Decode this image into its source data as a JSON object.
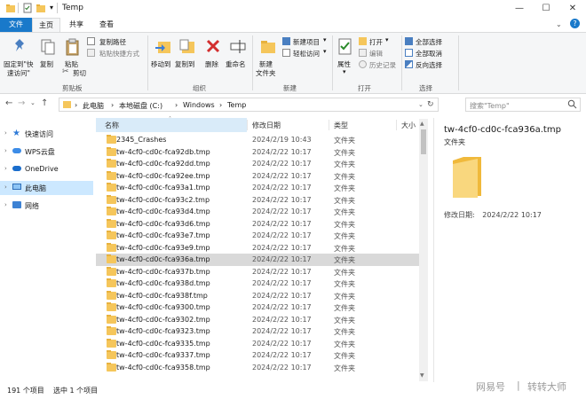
{
  "window": {
    "title": "Temp",
    "controls": {
      "minimize": "—",
      "maximize": "☐",
      "close": "✕"
    }
  },
  "tabs": {
    "file": "文件",
    "home": "主页",
    "share": "共享",
    "view": "查看"
  },
  "ribbon": {
    "clipboard": {
      "group": "剪贴板",
      "pin_line1": "固定到\"快",
      "pin_line2": "速访问\"",
      "copy": "复制",
      "paste": "粘贴",
      "copy_path": "复制路径",
      "paste_shortcut": "粘贴快捷方式",
      "cut": "剪切"
    },
    "organize": {
      "group": "组织",
      "move_to": "移动到",
      "copy_to": "复制到",
      "delete": "删除",
      "rename": "重命名"
    },
    "new": {
      "group": "新建",
      "new_folder_line1": "新建",
      "new_folder_line2": "文件夹",
      "new_item": "新建项目",
      "easy_access": "轻松访问"
    },
    "open": {
      "group": "打开",
      "properties": "属性",
      "open": "打开",
      "edit": "编辑",
      "history": "历史记录"
    },
    "select": {
      "group": "选择",
      "select_all": "全部选择",
      "select_none": "全部取消",
      "invert": "反向选择"
    }
  },
  "address": {
    "crumbs": [
      "此电脑",
      "本地磁盘 (C:)",
      "Windows",
      "Temp"
    ],
    "search_placeholder": "搜索\"Temp\""
  },
  "nav": {
    "items": [
      "快速访问",
      "WPS云盘",
      "OneDrive",
      "此电脑",
      "网络"
    ]
  },
  "columns": {
    "name": "名称",
    "date": "修改日期",
    "type": "类型",
    "size": "大小"
  },
  "files": [
    {
      "name": "2345_Crashes",
      "date": "2024/2/19 10:43",
      "type": "文件夹"
    },
    {
      "name": "tw-4cf0-cd0c-fca92db.tmp",
      "date": "2024/2/22 10:17",
      "type": "文件夹"
    },
    {
      "name": "tw-4cf0-cd0c-fca92dd.tmp",
      "date": "2024/2/22 10:17",
      "type": "文件夹"
    },
    {
      "name": "tw-4cf0-cd0c-fca92ee.tmp",
      "date": "2024/2/22 10:17",
      "type": "文件夹"
    },
    {
      "name": "tw-4cf0-cd0c-fca93a1.tmp",
      "date": "2024/2/22 10:17",
      "type": "文件夹"
    },
    {
      "name": "tw-4cf0-cd0c-fca93c2.tmp",
      "date": "2024/2/22 10:17",
      "type": "文件夹"
    },
    {
      "name": "tw-4cf0-cd0c-fca93d4.tmp",
      "date": "2024/2/22 10:17",
      "type": "文件夹"
    },
    {
      "name": "tw-4cf0-cd0c-fca93d6.tmp",
      "date": "2024/2/22 10:17",
      "type": "文件夹"
    },
    {
      "name": "tw-4cf0-cd0c-fca93e7.tmp",
      "date": "2024/2/22 10:17",
      "type": "文件夹"
    },
    {
      "name": "tw-4cf0-cd0c-fca93e9.tmp",
      "date": "2024/2/22 10:17",
      "type": "文件夹"
    },
    {
      "name": "tw-4cf0-cd0c-fca936a.tmp",
      "date": "2024/2/22 10:17",
      "type": "文件夹"
    },
    {
      "name": "tw-4cf0-cd0c-fca937b.tmp",
      "date": "2024/2/22 10:17",
      "type": "文件夹"
    },
    {
      "name": "tw-4cf0-cd0c-fca938d.tmp",
      "date": "2024/2/22 10:17",
      "type": "文件夹"
    },
    {
      "name": "tw-4cf0-cd0c-fca938f.tmp",
      "date": "2024/2/22 10:17",
      "type": "文件夹"
    },
    {
      "name": "tw-4cf0-cd0c-fca9300.tmp",
      "date": "2024/2/22 10:17",
      "type": "文件夹"
    },
    {
      "name": "tw-4cf0-cd0c-fca9302.tmp",
      "date": "2024/2/22 10:17",
      "type": "文件夹"
    },
    {
      "name": "tw-4cf0-cd0c-fca9323.tmp",
      "date": "2024/2/22 10:17",
      "type": "文件夹"
    },
    {
      "name": "tw-4cf0-cd0c-fca9335.tmp",
      "date": "2024/2/22 10:17",
      "type": "文件夹"
    },
    {
      "name": "tw-4cf0-cd0c-fca9337.tmp",
      "date": "2024/2/22 10:17",
      "type": "文件夹"
    },
    {
      "name": "tw-4cf0-cd0c-fca9358.tmp",
      "date": "2024/2/22 10:17",
      "type": "文件夹"
    }
  ],
  "selected_index": 10,
  "preview": {
    "name": "tw-4cf0-cd0c-fca936a.tmp",
    "type": "文件夹",
    "date_label": "修改日期:",
    "date_value": "2024/2/22 10:17"
  },
  "status": {
    "count": "191 个项目",
    "selected": "选中 1 个项目"
  },
  "watermark": {
    "left": "网易号",
    "right": "转转大师"
  },
  "colors": {
    "accent": "#1979ca",
    "selected_row": "#d9d9d9",
    "folder": "#f5c65b",
    "nav_selected": "#cce8ff"
  }
}
